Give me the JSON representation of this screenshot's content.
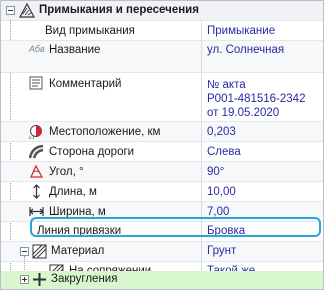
{
  "group": {
    "title": "Примыкания и пересечения"
  },
  "rows": [
    {
      "label": "Вид примыкания",
      "value": "Примыкание"
    },
    {
      "label": "Название",
      "value": "ул. Солнечная",
      "icon_text": "Абв"
    },
    {
      "label": "Комментарий",
      "value": "№ акта\nР001-481516-2342\nот 19.05.2020"
    },
    {
      "label": "Местоположение, км",
      "value": "0,203"
    },
    {
      "label": "Сторона дороги",
      "value": "Слева"
    },
    {
      "label": "Угол, °",
      "value": "90°"
    },
    {
      "label": "Длина, м",
      "value": "10,00"
    },
    {
      "label": "Ширина, м",
      "value": "7,00"
    },
    {
      "label": "Линия привязки",
      "value": "Бровка"
    },
    {
      "label": "Материал",
      "value": "Грунт"
    },
    {
      "label": "На сопряжении",
      "value": "Такой же"
    },
    {
      "label": "Закругления",
      "value": ""
    }
  ],
  "icons": {
    "group": "hatched-intersection-icon",
    "name": "text-abv-icon",
    "comment": "comment-lines-icon",
    "location": "location-half-circle-icon",
    "side": "road-side-icon",
    "angle": "angle-icon",
    "length": "length-arrow-icon",
    "width": "width-arrow-icon",
    "material": "hatched-material-icon",
    "junction": "hatched-junction-icon",
    "curves": "curves-icon"
  },
  "colors": {
    "value_text": "#2a2aa0",
    "highlight_border": "#27a6d8",
    "curves_row_bg": "#d9f7cf"
  }
}
